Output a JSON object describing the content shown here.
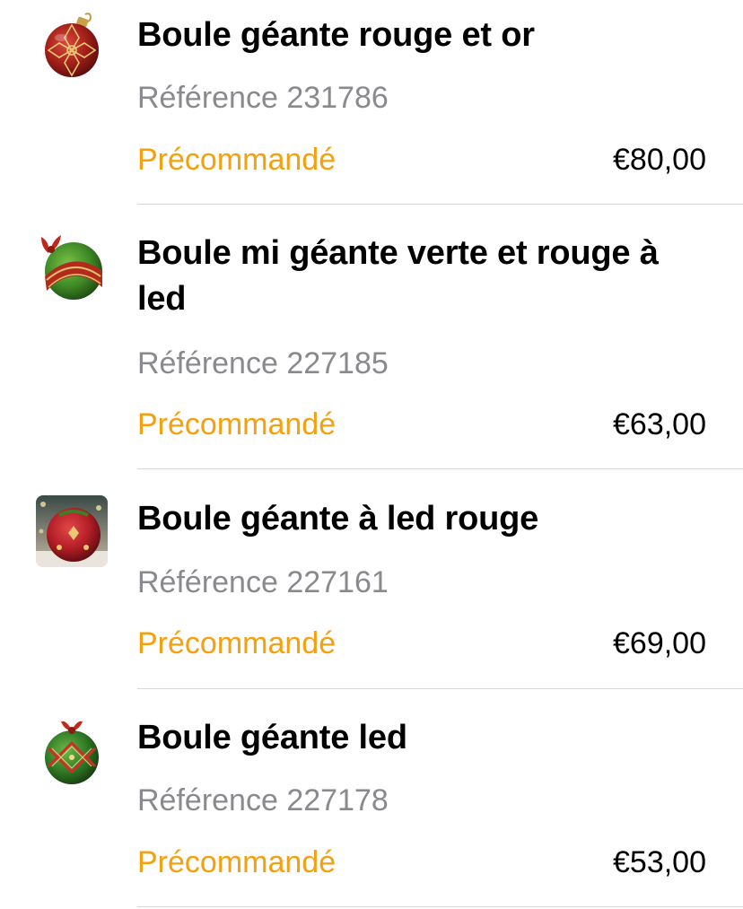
{
  "products": [
    {
      "title": "Boule géante rouge et or",
      "reference": "Référence 231786",
      "status": "Précommandé",
      "price": "€80,00",
      "thumbnail_icon": "red-gold-ornament-icon"
    },
    {
      "title": "Boule mi géante verte et rouge à led",
      "reference": "Référence 227185",
      "status": "Précommandé",
      "price": "€63,00",
      "thumbnail_icon": "green-red-ornament-icon"
    },
    {
      "title": "Boule géante à led rouge",
      "reference": "Référence 227161",
      "status": "Précommandé",
      "price": "€69,00",
      "thumbnail_icon": "red-led-ornament-photo-icon"
    },
    {
      "title": "Boule géante led",
      "reference": "Référence 227178",
      "status": "Précommandé",
      "price": "€53,00",
      "thumbnail_icon": "green-led-ornament-icon"
    }
  ],
  "colors": {
    "status": "#f5a00f",
    "reference": "#8a8a8e",
    "divider": "#d7d7da"
  }
}
